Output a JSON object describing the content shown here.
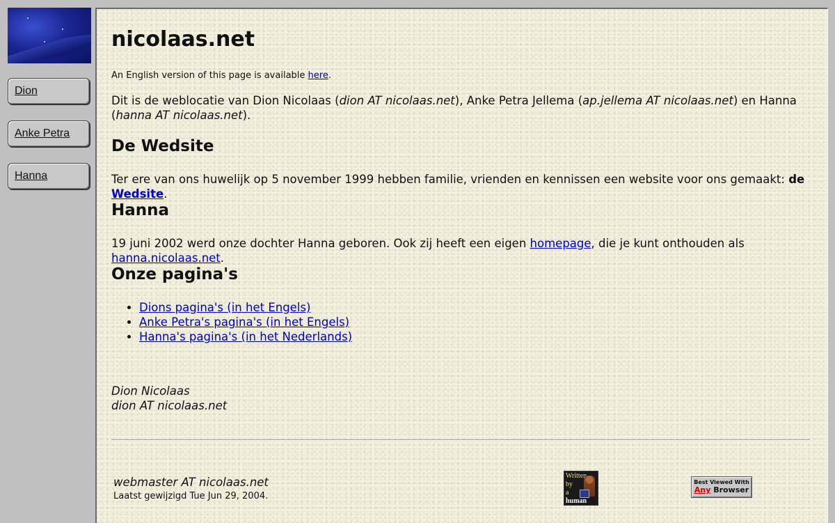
{
  "sidebar": {
    "items": [
      {
        "label": "Dion"
      },
      {
        "label": "Anke Petra"
      },
      {
        "label": "Hanna"
      }
    ]
  },
  "page": {
    "title": "nicolaas.net",
    "english_notice_prefix": "An English version of this page is available ",
    "english_notice_link": "here",
    "english_notice_suffix": ".",
    "intro": {
      "t1": "Dit is de weblocatie van Dion Nicolaas (",
      "email_dion": "dion AT nicolaas.net",
      "t2": "), Anke Petra Jellema (",
      "email_ap": "ap.jellema AT nicolaas.net",
      "t3": ") en Hanna (",
      "email_hanna": "hanna AT nicolaas.net",
      "t4": ")."
    },
    "section_wedsite": {
      "heading": "De Wedsite",
      "text": "Ter ere van ons huwelijk op 5 november 1999 hebben familie, vrienden en kennissen een website voor ons gemaakt: ",
      "bold_de": "de ",
      "link": "Wedsite",
      "suffix": "."
    },
    "section_hanna": {
      "heading": "Hanna",
      "t1": "19 juni 2002 werd onze dochter Hanna geboren. Ook zij heeft een eigen ",
      "link1": "homepage",
      "t2": ", die je kunt onthouden als ",
      "link2": "hanna.nicolaas.net",
      "t3": "."
    },
    "section_pages": {
      "heading": "Onze pagina's",
      "links": [
        "Dions pagina's (in het Engels)",
        "Anke Petra's pagina's (in het Engels)",
        "Hanna's pagina's (in het Nederlands)"
      ]
    },
    "signature": {
      "name": "Dion Nicolaas",
      "email": "dion AT nicolaas.net"
    },
    "footer": {
      "webmaster": "webmaster AT nicolaas.net",
      "modified": "Laatst gewijzigd Tue Jun 29, 2004.",
      "badge_human": [
        "Written",
        "by",
        "a",
        "human"
      ],
      "badge_browser_line1": "Best Viewed With",
      "badge_browser_any": "Any",
      "badge_browser_word": " Browser"
    }
  }
}
